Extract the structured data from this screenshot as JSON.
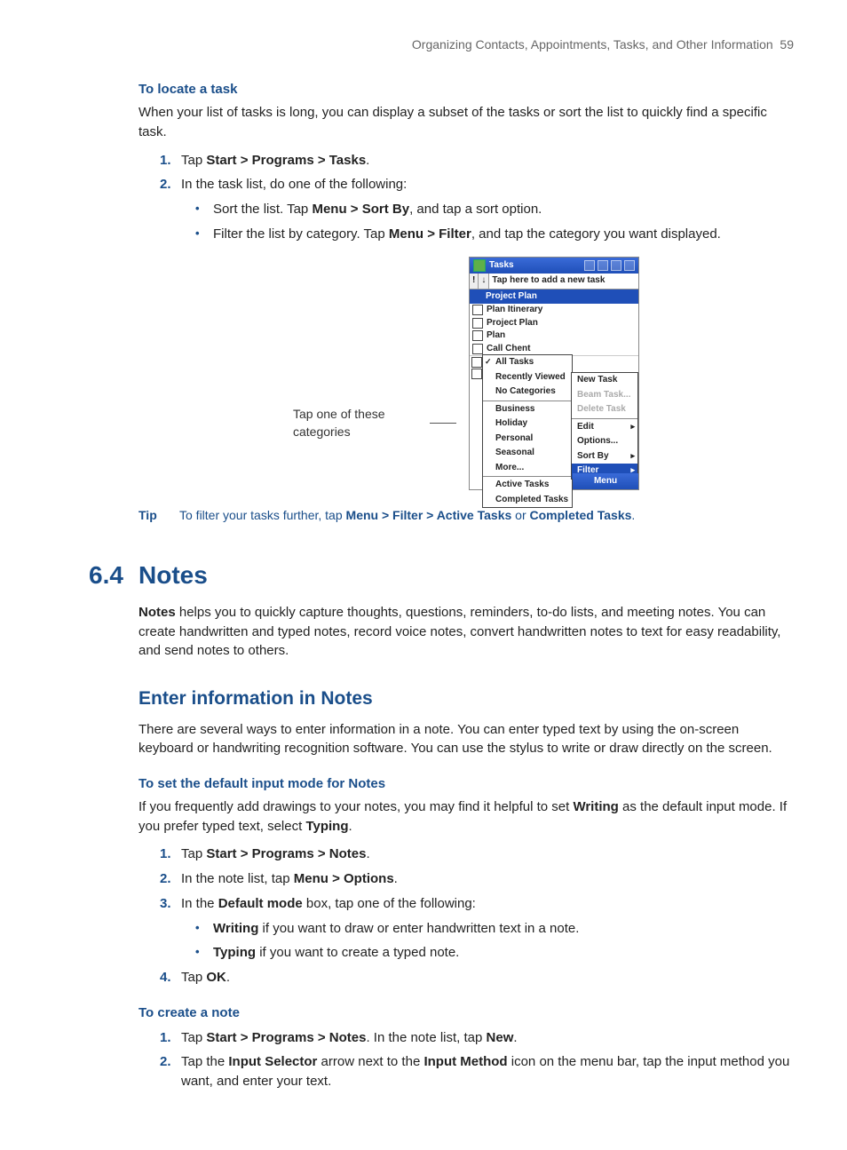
{
  "header": {
    "chapter_title": "Organizing Contacts, Appointments, Tasks, and Other Information",
    "page_number": "59"
  },
  "sectionA": {
    "h3_1": "To locate a task",
    "intro": "When your list of tasks is long, you can display a subset of the tasks or sort the list to quickly find a specific task.",
    "step1_pre": "Tap ",
    "step1_bold": "Start > Programs > Tasks",
    "step1_post": ".",
    "step2": "In the task list, do one of the following:",
    "bullet1_pre": "Sort the list. Tap ",
    "bullet1_bold": "Menu > Sort By",
    "bullet1_post": ", and tap a sort option.",
    "bullet2_pre": "Filter the list by category. Tap ",
    "bullet2_bold": "Menu > Filter",
    "bullet2_post": ", and tap the category you want displayed."
  },
  "figure": {
    "caption": "Tap one of these categories",
    "titlebar": "Tasks",
    "entry_hint": "Tap here to add a new task",
    "entry_icon1": "!",
    "entry_icon2": "↓",
    "selected_task": "Project Plan",
    "tasks": [
      "Plan Itinerary",
      "Project Plan",
      "Plan",
      "Call Chent"
    ],
    "left_menu": {
      "all": "All Tasks",
      "recent": "Recently Viewed",
      "nocat": "No Categories",
      "business": "Business",
      "holiday": "Holiday",
      "personal": "Personal",
      "seasonal": "Seasonal",
      "more": "More...",
      "active": "Active Tasks",
      "completed": "Completed Tasks"
    },
    "right_menu": {
      "new": "New Task",
      "beam": "Beam Task...",
      "delete": "Delete Task",
      "edit": "Edit",
      "options": "Options...",
      "sortby": "Sort By",
      "filter": "Filter"
    },
    "menubar": "Menu"
  },
  "tip": {
    "label": "Tip",
    "pre": "To filter your tasks further, tap ",
    "bold1": "Menu > Filter > Active Tasks",
    "mid": " or ",
    "bold2": "Completed Tasks",
    "post": "."
  },
  "sectionB": {
    "num": "6.4",
    "title": "Notes",
    "p1_b": "Notes",
    "p1": " helps you to quickly capture thoughts, questions, reminders, to-do lists, and meeting notes. You can create handwritten and typed notes, record voice notes, convert handwritten notes to text for easy readability, and send notes to others.",
    "h2": "Enter information in Notes",
    "p2": "There are several ways to enter information in a note. You can enter typed text by using the on-screen keyboard or handwriting recognition software. You can use the stylus to write or draw directly on the screen.",
    "h3_2": "To set the default input mode for Notes",
    "p3_pre": "If you frequently add drawings to your notes, you may find it helpful to set ",
    "p3_b1": "Writing",
    "p3_mid": " as the default input mode. If you prefer typed text, select ",
    "p3_b2": "Typing",
    "p3_post": ".",
    "s1_pre": "Tap ",
    "s1_b": "Start > Programs > Notes",
    "s1_post": ".",
    "s2_pre": "In the note list, tap ",
    "s2_b": "Menu > Options",
    "s2_post": ".",
    "s3_pre": "In the ",
    "s3_b": "Default mode",
    "s3_post": " box, tap one of the following:",
    "s3b1_b": "Writing",
    "s3b1_t": " if you want to draw or enter handwritten text in a note.",
    "s3b2_b": "Typing",
    "s3b2_t": " if you want to create a typed note.",
    "s4_pre": "Tap ",
    "s4_b": "OK",
    "s4_post": ".",
    "h3_3": "To create a note",
    "c1_pre": "Tap ",
    "c1_b1": "Start > Programs > Notes",
    "c1_mid": ". In the note list, tap ",
    "c1_b2": "New",
    "c1_post": ".",
    "c2_pre": "Tap the ",
    "c2_b1": "Input Selector",
    "c2_mid1": " arrow next to the ",
    "c2_b2": "Input Method",
    "c2_mid2": " icon on the menu bar, tap the input method you want, and enter your text."
  }
}
